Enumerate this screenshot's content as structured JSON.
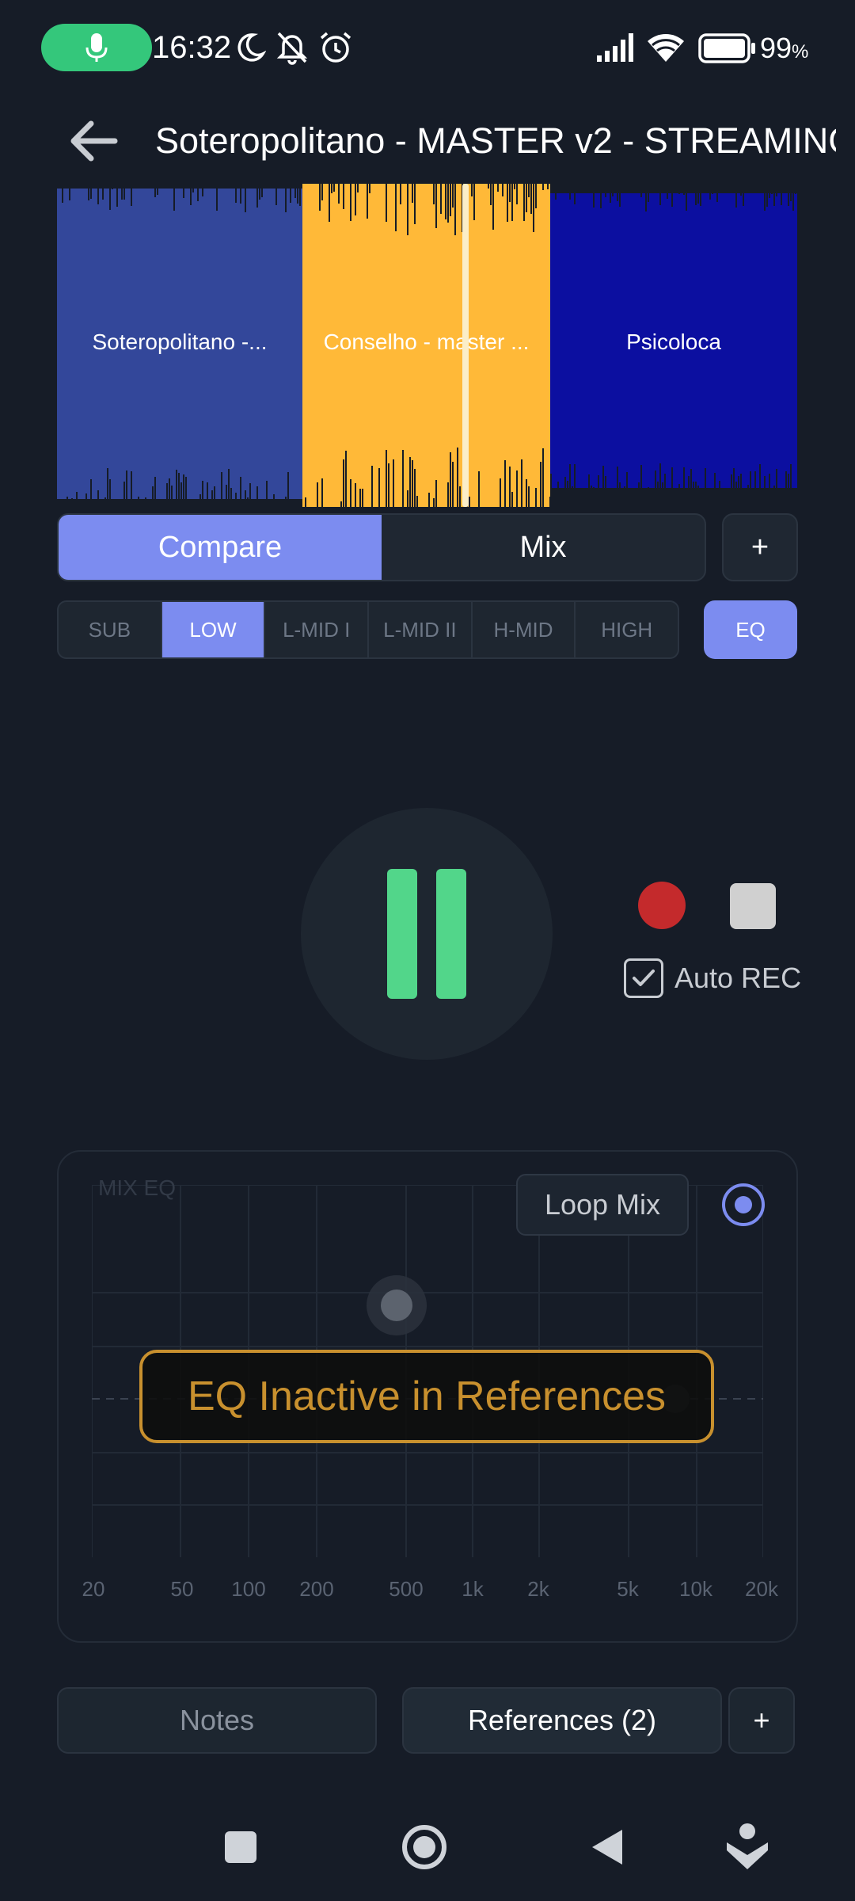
{
  "status_bar": {
    "time": "16:32",
    "battery_percent": "99",
    "battery_unit": "%",
    "icons": [
      "mic-icon",
      "moon-icon",
      "bell-off-icon",
      "alarm-icon",
      "signal-icon",
      "wifi-icon",
      "battery-icon"
    ]
  },
  "header": {
    "title": "Soteropolitano - MASTER v2 - STREAMING"
  },
  "waveform": {
    "segments": [
      {
        "label": "Soteropolitano -...",
        "color": "#33479a"
      },
      {
        "label": "Conselho - master ...",
        "color": "#ffb938"
      },
      {
        "label": "Psicoloca",
        "color": "#0c0fa0"
      }
    ]
  },
  "mode_tabs": {
    "compare": "Compare",
    "mix": "Mix",
    "add": "+"
  },
  "bands": {
    "items": [
      "SUB",
      "LOW",
      "L-MID I",
      "L-MID II",
      "H-MID",
      "HIGH"
    ],
    "active": "LOW",
    "eq_button": "EQ"
  },
  "transport": {
    "state": "playing",
    "auto_rec_label": "Auto REC",
    "auto_rec_checked": true
  },
  "eq_panel": {
    "title": "MIX EQ",
    "loop_mix": "Loop Mix",
    "overlay_message": "EQ Inactive in References",
    "freq_labels": [
      "20",
      "50",
      "100",
      "200",
      "500",
      "1k",
      "2k",
      "5k",
      "10k",
      "20k"
    ]
  },
  "bottom_tabs": {
    "notes": "Notes",
    "references": "References (2)",
    "add": "+"
  },
  "colors": {
    "background": "#161c27",
    "accent": "#7c8cf0",
    "play": "#52d68a",
    "record": "#c42a2c",
    "warning": "#c8902e"
  }
}
